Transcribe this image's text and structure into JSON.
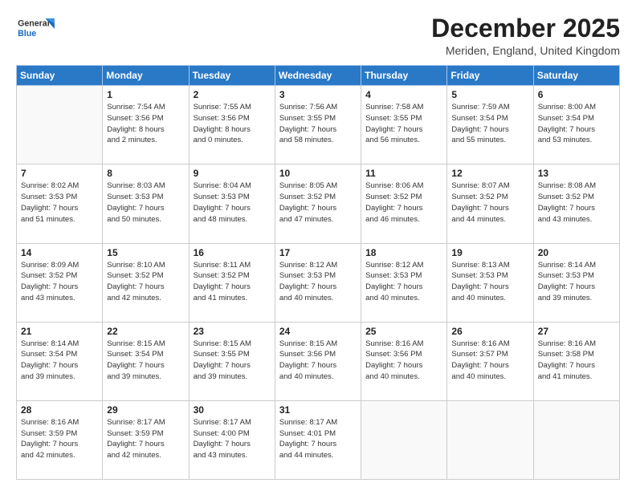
{
  "header": {
    "logo_general": "General",
    "logo_blue": "Blue",
    "title": "December 2025",
    "location": "Meriden, England, United Kingdom"
  },
  "weekdays": [
    "Sunday",
    "Monday",
    "Tuesday",
    "Wednesday",
    "Thursday",
    "Friday",
    "Saturday"
  ],
  "weeks": [
    [
      {
        "day": "",
        "info": ""
      },
      {
        "day": "1",
        "info": "Sunrise: 7:54 AM\nSunset: 3:56 PM\nDaylight: 8 hours\nand 2 minutes."
      },
      {
        "day": "2",
        "info": "Sunrise: 7:55 AM\nSunset: 3:56 PM\nDaylight: 8 hours\nand 0 minutes."
      },
      {
        "day": "3",
        "info": "Sunrise: 7:56 AM\nSunset: 3:55 PM\nDaylight: 7 hours\nand 58 minutes."
      },
      {
        "day": "4",
        "info": "Sunrise: 7:58 AM\nSunset: 3:55 PM\nDaylight: 7 hours\nand 56 minutes."
      },
      {
        "day": "5",
        "info": "Sunrise: 7:59 AM\nSunset: 3:54 PM\nDaylight: 7 hours\nand 55 minutes."
      },
      {
        "day": "6",
        "info": "Sunrise: 8:00 AM\nSunset: 3:54 PM\nDaylight: 7 hours\nand 53 minutes."
      }
    ],
    [
      {
        "day": "7",
        "info": "Sunrise: 8:02 AM\nSunset: 3:53 PM\nDaylight: 7 hours\nand 51 minutes."
      },
      {
        "day": "8",
        "info": "Sunrise: 8:03 AM\nSunset: 3:53 PM\nDaylight: 7 hours\nand 50 minutes."
      },
      {
        "day": "9",
        "info": "Sunrise: 8:04 AM\nSunset: 3:53 PM\nDaylight: 7 hours\nand 48 minutes."
      },
      {
        "day": "10",
        "info": "Sunrise: 8:05 AM\nSunset: 3:52 PM\nDaylight: 7 hours\nand 47 minutes."
      },
      {
        "day": "11",
        "info": "Sunrise: 8:06 AM\nSunset: 3:52 PM\nDaylight: 7 hours\nand 46 minutes."
      },
      {
        "day": "12",
        "info": "Sunrise: 8:07 AM\nSunset: 3:52 PM\nDaylight: 7 hours\nand 44 minutes."
      },
      {
        "day": "13",
        "info": "Sunrise: 8:08 AM\nSunset: 3:52 PM\nDaylight: 7 hours\nand 43 minutes."
      }
    ],
    [
      {
        "day": "14",
        "info": "Sunrise: 8:09 AM\nSunset: 3:52 PM\nDaylight: 7 hours\nand 43 minutes."
      },
      {
        "day": "15",
        "info": "Sunrise: 8:10 AM\nSunset: 3:52 PM\nDaylight: 7 hours\nand 42 minutes."
      },
      {
        "day": "16",
        "info": "Sunrise: 8:11 AM\nSunset: 3:52 PM\nDaylight: 7 hours\nand 41 minutes."
      },
      {
        "day": "17",
        "info": "Sunrise: 8:12 AM\nSunset: 3:53 PM\nDaylight: 7 hours\nand 40 minutes."
      },
      {
        "day": "18",
        "info": "Sunrise: 8:12 AM\nSunset: 3:53 PM\nDaylight: 7 hours\nand 40 minutes."
      },
      {
        "day": "19",
        "info": "Sunrise: 8:13 AM\nSunset: 3:53 PM\nDaylight: 7 hours\nand 40 minutes."
      },
      {
        "day": "20",
        "info": "Sunrise: 8:14 AM\nSunset: 3:53 PM\nDaylight: 7 hours\nand 39 minutes."
      }
    ],
    [
      {
        "day": "21",
        "info": "Sunrise: 8:14 AM\nSunset: 3:54 PM\nDaylight: 7 hours\nand 39 minutes."
      },
      {
        "day": "22",
        "info": "Sunrise: 8:15 AM\nSunset: 3:54 PM\nDaylight: 7 hours\nand 39 minutes."
      },
      {
        "day": "23",
        "info": "Sunrise: 8:15 AM\nSunset: 3:55 PM\nDaylight: 7 hours\nand 39 minutes."
      },
      {
        "day": "24",
        "info": "Sunrise: 8:15 AM\nSunset: 3:56 PM\nDaylight: 7 hours\nand 40 minutes."
      },
      {
        "day": "25",
        "info": "Sunrise: 8:16 AM\nSunset: 3:56 PM\nDaylight: 7 hours\nand 40 minutes."
      },
      {
        "day": "26",
        "info": "Sunrise: 8:16 AM\nSunset: 3:57 PM\nDaylight: 7 hours\nand 40 minutes."
      },
      {
        "day": "27",
        "info": "Sunrise: 8:16 AM\nSunset: 3:58 PM\nDaylight: 7 hours\nand 41 minutes."
      }
    ],
    [
      {
        "day": "28",
        "info": "Sunrise: 8:16 AM\nSunset: 3:59 PM\nDaylight: 7 hours\nand 42 minutes."
      },
      {
        "day": "29",
        "info": "Sunrise: 8:17 AM\nSunset: 3:59 PM\nDaylight: 7 hours\nand 42 minutes."
      },
      {
        "day": "30",
        "info": "Sunrise: 8:17 AM\nSunset: 4:00 PM\nDaylight: 7 hours\nand 43 minutes."
      },
      {
        "day": "31",
        "info": "Sunrise: 8:17 AM\nSunset: 4:01 PM\nDaylight: 7 hours\nand 44 minutes."
      },
      {
        "day": "",
        "info": ""
      },
      {
        "day": "",
        "info": ""
      },
      {
        "day": "",
        "info": ""
      }
    ]
  ]
}
